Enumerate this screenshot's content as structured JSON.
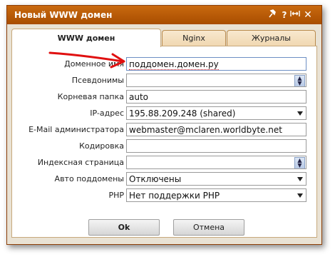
{
  "dialog": {
    "title": "Новый WWW домен",
    "title_icons": {
      "pin": "pin-icon",
      "help": "?",
      "resize": "resize-icon",
      "close": "✕"
    }
  },
  "tabs": [
    {
      "label": "WWW домен",
      "active": true
    },
    {
      "label": "Nginx",
      "active": false
    },
    {
      "label": "Журналы",
      "active": false
    }
  ],
  "form": {
    "domain_label": "Доменное имя",
    "domain_value": "поддомен.домен.ру",
    "aliases_label": "Псевдонимы",
    "aliases_value": "",
    "root_label": "Корневая папка",
    "root_value": "auto",
    "ip_label": "IP-адрес",
    "ip_value": "195.88.209.248 (shared)",
    "email_label": "E-Mail администратора",
    "email_value": "webmaster@mclaren.worldbyte.net",
    "charset_label": "Кодировка",
    "charset_value": "",
    "index_label": "Индексная страница",
    "index_value": "",
    "autosub_label": "Авто поддомены",
    "autosub_value": "Отключены",
    "php_label": "PHP",
    "php_value": "Нет поддержки PHP"
  },
  "buttons": {
    "ok": "Ok",
    "cancel": "Отмена"
  },
  "colors": {
    "titlebar": "#b65a05",
    "annotation_arrow": "#e01010",
    "focus_border": "#6d8fc4"
  }
}
